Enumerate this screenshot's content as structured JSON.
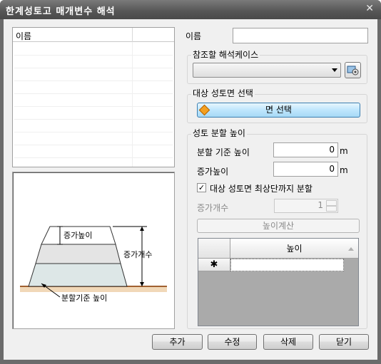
{
  "window": {
    "title": "한계성토고 매개변수 해석"
  },
  "list": {
    "column_name": "이름"
  },
  "diagram": {
    "increment_height_label": "증가높이",
    "increment_count_label": "증가개수",
    "base_height_label": "분할기준 높이"
  },
  "name_field": {
    "label": "이름",
    "value": ""
  },
  "reference_case": {
    "title": "참조할 해석케이스",
    "selected": ""
  },
  "target_face": {
    "title": "대상 성토면 선택",
    "button": "면 선택"
  },
  "split_height": {
    "title": "성토 분할 높이",
    "base_height_label": "분할 기준 높이",
    "base_height_value": "0",
    "increment_label": "증가높이",
    "increment_value": "0",
    "unit": "m",
    "checkbox_label": "대상 성토면 최상단까지 분할",
    "checkbox_checked": true,
    "count_label": "증가개수",
    "count_value": "1",
    "compute_button": "높이계산",
    "grid_header": "높이",
    "new_row_marker": "✱"
  },
  "footer": {
    "add": "추가",
    "edit": "수정",
    "delete": "삭제",
    "close": "닫기"
  },
  "colors": {
    "accent_button": "#bee6fd",
    "diamond": "#f4a020"
  }
}
